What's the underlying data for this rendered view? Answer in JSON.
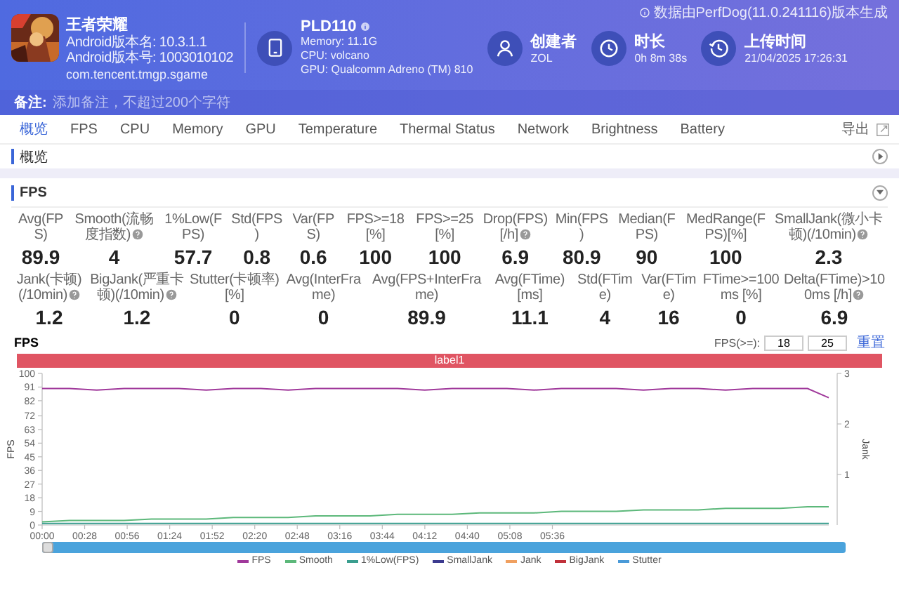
{
  "header": {
    "app": {
      "name": "王者荣耀",
      "lines": [
        "Android版本名: 10.3.1.1",
        "Android版本号: 1003010102"
      ],
      "package": "com.tencent.tmgp.sgame"
    },
    "device": {
      "name": "PLD110",
      "lines": [
        "Memory: 11.1G",
        "CPU: volcano",
        "GPU: Qualcomm Adreno (TM) 810"
      ]
    },
    "infos": [
      {
        "kind": "user",
        "title": "创建者",
        "value": "ZOL"
      },
      {
        "kind": "clock",
        "title": "时长",
        "value": "0h 8m 38s"
      },
      {
        "kind": "history",
        "title": "上传时间",
        "value": "21/04/2025 17:26:31"
      }
    ],
    "note": "数据由PerfDog(11.0.241116)版本生成",
    "remark": {
      "label": "备注:",
      "placeholder": "添加备注，不超过200个字符"
    }
  },
  "tabs": [
    {
      "label": "概览",
      "selected": true
    },
    {
      "label": "FPS",
      "selected": false
    },
    {
      "label": "CPU",
      "selected": false
    },
    {
      "label": "Memory",
      "selected": false
    },
    {
      "label": "GPU",
      "selected": false
    },
    {
      "label": "Temperature",
      "selected": false
    },
    {
      "label": "Thermal Status",
      "selected": false
    },
    {
      "label": "Network",
      "selected": false
    },
    {
      "label": "Brightness",
      "selected": false
    },
    {
      "label": "Battery",
      "selected": false
    }
  ],
  "export": "导出",
  "sections": [
    {
      "title": "概览",
      "expanded": false
    },
    {
      "title": "FPS",
      "expanded": true
    }
  ],
  "metrics": {
    "lines": [
      {
        "items": [
          {
            "label": "Avg(FPS)",
            "value": "89.9",
            "help": false
          },
          {
            "label": "Smooth(流畅度指数)",
            "value": "4",
            "help": true
          },
          {
            "label": "1%Low(FPS)",
            "value": "57.7",
            "help": false
          },
          {
            "label": "Std(FPS)",
            "value": "0.8",
            "help": false
          },
          {
            "label": "Var(FPS)",
            "value": "0.6",
            "help": false
          },
          {
            "label": "FPS>=18 [%]",
            "value": "100",
            "help": false
          },
          {
            "label": "FPS>=25 [%]",
            "value": "100",
            "help": false
          },
          {
            "label": "Drop(FPS) [/h]",
            "value": "6.9",
            "help": true
          },
          {
            "label": "Min(FPS)",
            "value": "80.9",
            "help": false
          },
          {
            "label": "Median(FPS)",
            "value": "90",
            "help": false
          },
          {
            "label": "MedRange(FPS)[%]",
            "value": "100",
            "help": false
          },
          {
            "label": "SmallJank(微小卡顿)(/10min)",
            "value": "2.3",
            "help": true
          }
        ]
      },
      {
        "items": [
          {
            "label": "Jank(卡顿)(/10min)",
            "value": "1.2",
            "help": true
          },
          {
            "label": "BigJank(严重卡顿)(/10min)",
            "value": "1.2",
            "help": true
          },
          {
            "label": "Stutter(卡顿率) [%]",
            "value": "0",
            "help": false
          },
          {
            "label": "Avg(InterFrame)",
            "value": "0",
            "help": false
          },
          {
            "label": "Avg(FPS+InterFrame)",
            "value": "89.9",
            "help": false
          },
          {
            "label": "Avg(FTime) [ms]",
            "value": "11.1",
            "help": false
          },
          {
            "label": "Std(FTime)",
            "value": "4",
            "help": false
          },
          {
            "label": "Var(FTime)",
            "value": "16",
            "help": false
          },
          {
            "label": "FTime>=100ms [%]",
            "value": "0",
            "help": false
          },
          {
            "label": "Delta(FTime)>100ms [/h]",
            "value": "6.9",
            "help": true
          }
        ]
      }
    ]
  },
  "fps_chart": {
    "title": "FPS",
    "threshold_label": "FPS(>=):",
    "thresholds": [
      "18",
      "25"
    ],
    "reset": "重置",
    "label_bar": "label1",
    "legend_extra": [
      {
        "name": "SmallJank",
        "color": "#3c3a8f"
      },
      {
        "name": "Jank",
        "color": "#f0a060"
      },
      {
        "name": "BigJank",
        "color": "#c0303a"
      },
      {
        "name": "Stutter",
        "color": "#4a9ad8"
      }
    ],
    "chart_data": {
      "type": "line",
      "legend": "bottom",
      "ylabel": "FPS",
      "y2label": "Jank",
      "ylim": [
        0,
        100
      ],
      "yticks": [
        0,
        9,
        18,
        27,
        36,
        45,
        54,
        63,
        72,
        82,
        91,
        100
      ],
      "y2ticks": [
        1,
        2,
        3
      ],
      "y2lim": [
        0,
        3
      ],
      "xlim": [
        0,
        518
      ],
      "xticks": [
        {
          "value": 0,
          "label": "00:00"
        },
        {
          "value": 28,
          "label": "00:28"
        },
        {
          "value": 56,
          "label": "00:56"
        },
        {
          "value": 84,
          "label": "01:24"
        },
        {
          "value": 112,
          "label": "01:52"
        },
        {
          "value": 140,
          "label": "02:20"
        },
        {
          "value": 168,
          "label": "02:48"
        },
        {
          "value": 196,
          "label": "03:16"
        },
        {
          "value": 224,
          "label": "03:44"
        },
        {
          "value": 252,
          "label": "04:12"
        },
        {
          "value": 280,
          "label": "04:40"
        },
        {
          "value": 308,
          "label": "05:08"
        },
        {
          "value": 336,
          "label": "05:36"
        }
      ],
      "x": [
        0,
        18,
        36,
        54,
        72,
        90,
        108,
        126,
        144,
        162,
        180,
        198,
        216,
        234,
        252,
        270,
        288,
        306,
        324,
        342,
        360,
        378,
        396,
        414,
        432,
        450,
        468,
        486,
        504,
        518
      ],
      "series": [
        {
          "name": "FPS",
          "color": "#a0399b",
          "values": [
            90,
            90,
            89,
            90,
            90,
            90,
            89,
            90,
            90,
            89,
            90,
            90,
            90,
            90,
            89,
            90,
            90,
            90,
            89,
            90,
            90,
            90,
            89,
            90,
            90,
            89,
            90,
            90,
            90,
            84
          ]
        },
        {
          "name": "Smooth",
          "color": "#5cb87a",
          "values": [
            2,
            3,
            3,
            3,
            4,
            4,
            4,
            5,
            5,
            5,
            6,
            6,
            6,
            7,
            7,
            7,
            8,
            8,
            8,
            9,
            9,
            9,
            10,
            10,
            10,
            11,
            11,
            11,
            12,
            12
          ]
        },
        {
          "name": "1%Low(FPS)",
          "color": "#3a9e8f",
          "values": [
            1,
            1,
            1,
            1,
            1,
            1,
            1,
            1,
            1,
            1,
            1,
            1,
            1,
            1,
            1,
            1,
            1,
            1,
            1,
            1,
            1,
            1,
            1,
            1,
            1,
            1,
            1,
            1,
            1,
            1
          ]
        }
      ]
    }
  }
}
